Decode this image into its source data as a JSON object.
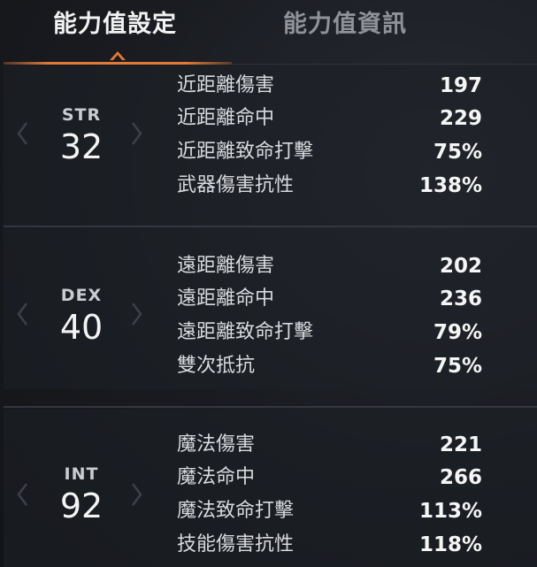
{
  "tabs": [
    {
      "label": "能力值設定",
      "active": true
    },
    {
      "label": "能力值資訊",
      "active": false
    }
  ],
  "accent_color": "#e07a36",
  "stats": [
    {
      "abbr": "STR",
      "value": "32",
      "rows": [
        {
          "label": "近距離傷害",
          "value": "197"
        },
        {
          "label": "近距離命中",
          "value": "229"
        },
        {
          "label": "近距離致命打擊",
          "value": "75%"
        },
        {
          "label": "武器傷害抗性",
          "value": "138%"
        }
      ]
    },
    {
      "abbr": "DEX",
      "value": "40",
      "rows": [
        {
          "label": "遠距離傷害",
          "value": "202"
        },
        {
          "label": "遠距離命中",
          "value": "236"
        },
        {
          "label": "遠距離致命打擊",
          "value": "79%"
        },
        {
          "label": "雙次抵抗",
          "value": "75%"
        }
      ]
    },
    {
      "abbr": "INT",
      "value": "92",
      "rows": [
        {
          "label": "魔法傷害",
          "value": "221"
        },
        {
          "label": "魔法命中",
          "value": "266"
        },
        {
          "label": "魔法致命打擊",
          "value": "113%"
        },
        {
          "label": "技能傷害抗性",
          "value": "118%"
        }
      ]
    }
  ],
  "icons": {
    "decrease": "chevron-left-icon",
    "increase": "chevron-right-icon"
  }
}
